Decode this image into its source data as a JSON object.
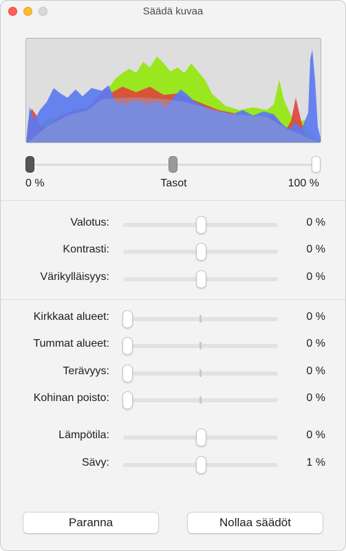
{
  "window": {
    "title": "Säädä kuvaa"
  },
  "histogram": {
    "colors": {
      "red": "#e0443a",
      "green": "#9ae61f",
      "blue": "#5b79f0"
    }
  },
  "levels": {
    "left_label": "0 %",
    "center_label": "Tasot",
    "right_label": "100 %"
  },
  "adjustments": {
    "exposure": {
      "label": "Valotus:",
      "value": "0 %"
    },
    "contrast": {
      "label": "Kontrasti:",
      "value": "0 %"
    },
    "saturation": {
      "label": "Värikylläisyys:",
      "value": "0 %"
    },
    "highlights": {
      "label": "Kirkkaat alueet:",
      "value": "0 %"
    },
    "shadows": {
      "label": "Tummat alueet:",
      "value": "0 %"
    },
    "sharpness": {
      "label": "Terävyys:",
      "value": "0 %"
    },
    "noise_reduction": {
      "label": "Kohinan poisto:",
      "value": "0 %"
    },
    "temperature": {
      "label": "Lämpötila:",
      "value": "0 %"
    },
    "tint": {
      "label": "Sävy:",
      "value": "1 %"
    }
  },
  "buttons": {
    "enhance_label": "Paranna",
    "reset_label": "Nollaa säädöt"
  }
}
